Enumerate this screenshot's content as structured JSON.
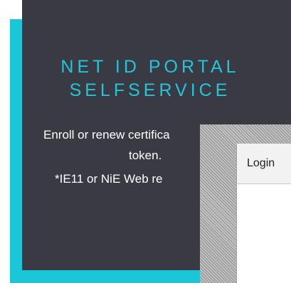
{
  "portal": {
    "title_line1": "NET ID PORTAL",
    "title_line2": "SELFSERVICE",
    "description_line1": "Enroll or renew certifica",
    "description_line2": "token.",
    "description_line3": "*IE11 or NiE Web re"
  },
  "login_dialog": {
    "title": "Login"
  },
  "colors": {
    "accent": "#1bc6d6",
    "panel": "#3a3a45"
  }
}
